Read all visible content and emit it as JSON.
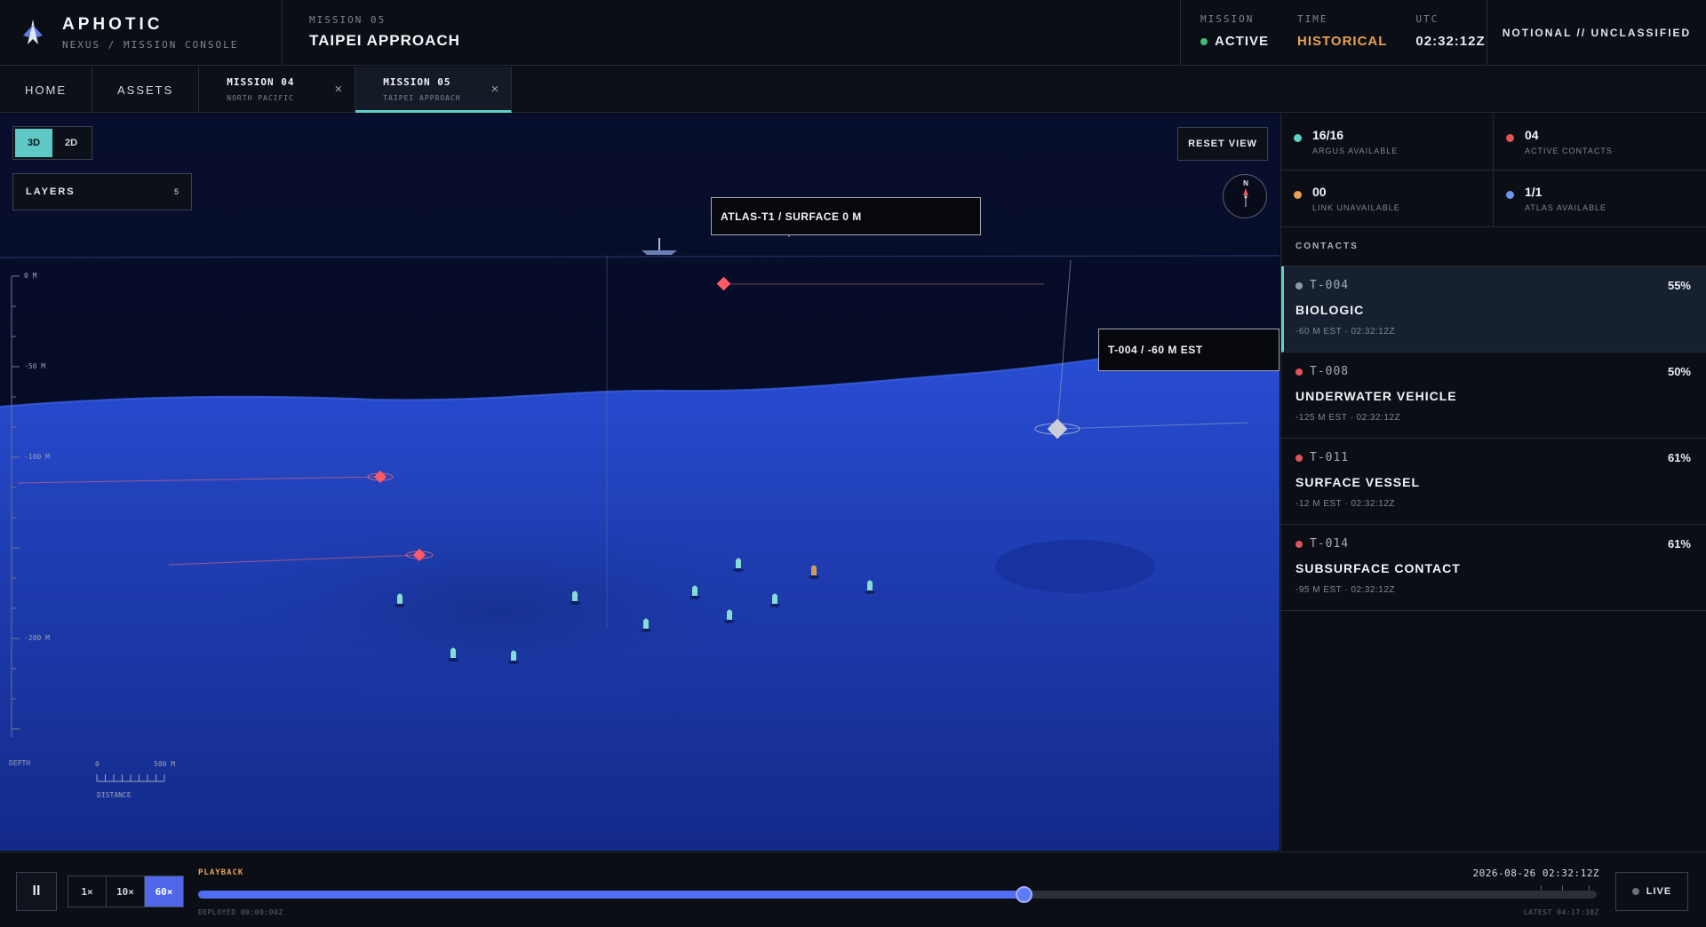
{
  "brand": {
    "name": "APHOTIC",
    "subtitle": "NEXUS / MISSION CONSOLE"
  },
  "header": {
    "mission_label": "MISSION 05",
    "mission_title": "TAIPEI APPROACH",
    "status": {
      "mission_label": "MISSION",
      "mission_value": "ACTIVE",
      "time_label": "TIME",
      "time_value": "HISTORICAL",
      "utc_label": "UTC",
      "utc_value": "02:32:12Z"
    },
    "classification": "NOTIONAL // UNCLASSIFIED"
  },
  "tabs": {
    "home": "HOME",
    "assets": "ASSETS",
    "docs": [
      {
        "title": "MISSION 04",
        "subtitle": "NORTH PACIFIC",
        "close": "×"
      },
      {
        "title": "MISSION 05",
        "subtitle": "TAIPEI APPROACH",
        "close": "×"
      }
    ]
  },
  "map": {
    "view_3d": "3D",
    "view_2d": "2D",
    "layers_label": "LAYERS",
    "layers_count": "5",
    "reset_label": "RESET VIEW",
    "compass_n": "N",
    "callout_atlas": "ATLAS-T1  /  SURFACE 0 M",
    "callout_contact": "T-004  /  -60 M EST",
    "depth_ticks": [
      "0 M",
      "-50 M",
      "-100 M",
      "-200 M"
    ],
    "depth_label": "DEPTH",
    "scale_start": "0",
    "scale_end": "500 M",
    "distance_label": "DISTANCE"
  },
  "sidebar": {
    "stats": [
      {
        "value": "16/16",
        "label": "ARGUS AVAILABLE"
      },
      {
        "value": "04",
        "label": "ACTIVE CONTACTS"
      },
      {
        "value": "00",
        "label": "LINK UNAVAILABLE"
      },
      {
        "value": "1/1",
        "label": "ATLAS AVAILABLE"
      }
    ],
    "contacts_label": "CONTACTS",
    "contacts": [
      {
        "id": "T-004",
        "pct": "55%",
        "name": "BIOLOGIC",
        "meta": "-60 M EST · 02:32:12Z"
      },
      {
        "id": "T-008",
        "pct": "50%",
        "name": "UNDERWATER VEHICLE",
        "meta": "-125 M EST · 02:32:12Z"
      },
      {
        "id": "T-011",
        "pct": "61%",
        "name": "SURFACE VESSEL",
        "meta": "-12 M EST · 02:32:12Z"
      },
      {
        "id": "T-014",
        "pct": "61%",
        "name": "SUBSURFACE CONTACT",
        "meta": "-95 M EST · 02:32:12Z"
      }
    ]
  },
  "playback": {
    "pause_icon": "II",
    "speeds": [
      "1×",
      "10×",
      "60×"
    ],
    "label": "PLAYBACK",
    "current": "2026-08-26 02:32:12Z",
    "deployed": "DEPLOYED 00:00:00Z",
    "latest": "LATEST 04:17:38Z",
    "progress": 0.59,
    "live_label": "LIVE"
  },
  "colors": {
    "accent_teal": "#5fd0c8",
    "accent_blue": "#4f67e8",
    "status_green": "#3fbf73",
    "status_orange": "#e8a155",
    "contact_red": "#e0525a",
    "contact_grey": "#8f97a6",
    "atlas_blue": "#6b93f0"
  },
  "icons": {
    "brand": "arrowhead-logo-icon",
    "close": "close-icon",
    "pause": "pause-icon",
    "live": "live-dot-icon",
    "compass": "compass-icon"
  }
}
